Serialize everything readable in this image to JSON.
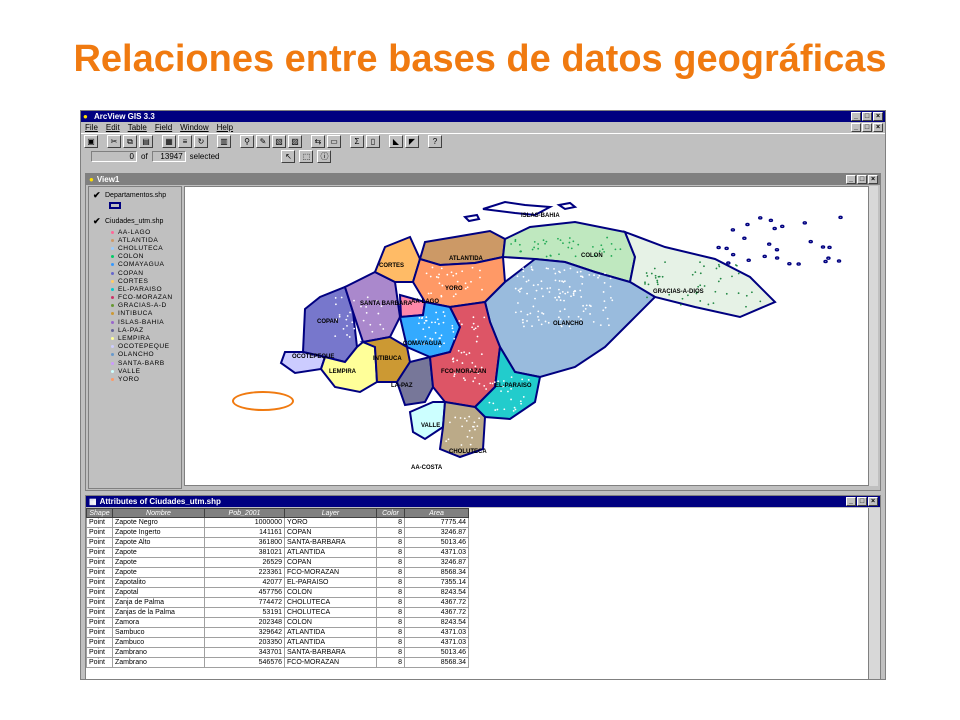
{
  "slide": {
    "title": "Relaciones entre bases de datos geográficas"
  },
  "app": {
    "title": "ArcView GIS 3.3",
    "menu": [
      "File",
      "Edit",
      "Table",
      "Field",
      "Window",
      "Help"
    ],
    "status": {
      "selected_count": "0",
      "of_label": "of",
      "total": "13947",
      "selected_label": "selected"
    }
  },
  "view": {
    "title": "View1",
    "toc": {
      "layer1": "Departamentos.shp",
      "layer2": "Ciudades_utm.shp",
      "legend": [
        {
          "label": "AA-LAGO",
          "color": "#ff6699"
        },
        {
          "label": "ATLANTIDA",
          "color": "#cc9966"
        },
        {
          "label": "CHOLUTECA",
          "color": "#99ccff"
        },
        {
          "label": "COLON",
          "color": "#00cc66"
        },
        {
          "label": "COMAYAGUA",
          "color": "#3399ff"
        },
        {
          "label": "COPAN",
          "color": "#6666cc"
        },
        {
          "label": "CORTES",
          "color": "#ffcc66"
        },
        {
          "label": "EL-PARAISO",
          "color": "#00cccc"
        },
        {
          "label": "FCO-MORAZAN",
          "color": "#cc3366"
        },
        {
          "label": "GRACIAS-A-D",
          "color": "#669933"
        },
        {
          "label": "INTIBUCA",
          "color": "#cc9933"
        },
        {
          "label": "ISLAS-BAHIA",
          "color": "#9966cc"
        },
        {
          "label": "LA-PAZ",
          "color": "#666699"
        },
        {
          "label": "LEMPIRA",
          "color": "#ffff99"
        },
        {
          "label": "OCOTEPEQUE",
          "color": "#ccccff"
        },
        {
          "label": "OLANCHO",
          "color": "#6699cc"
        },
        {
          "label": "SANTA-BARB",
          "color": "#cc99ff"
        },
        {
          "label": "VALLE",
          "color": "#ccffff"
        },
        {
          "label": "YORO",
          "color": "#ff9966"
        }
      ]
    },
    "map_labels": {
      "islas_bahia": "ISLAS-BAHIA",
      "colon": "COLON",
      "atlantida": "ATLANTIDA",
      "cortes": "CORTES",
      "yoro": "YORO",
      "gracias": "GRACIAS-A-DIOS",
      "santa_barbara": "SANTA\nBARBARA",
      "aa_lago": "AA-LAGO",
      "copan": "COPAN",
      "olancho": "OLANCHO",
      "comayagua": "COMAYAGUA",
      "ocotepeque": "OCOTEPEQUE",
      "intibuca": "INTIBUCA",
      "lempira": "LEMPIRA",
      "fco_morazan": "FCO-MORAZAN",
      "la_paz": "LA-PAZ",
      "el_paraiso": "EL-PARAISO",
      "valle": "VALLE",
      "choluteca": "CHOLUTECA",
      "aa_costa": "AA-COSTA"
    },
    "colors": {
      "border": "#000080"
    }
  },
  "attributes": {
    "title": "Attributes of Ciudades_utm.shp",
    "columns": [
      "Shape",
      "Nombre",
      "Pob_2001",
      "Layer",
      "Color",
      "Area"
    ],
    "rows": [
      [
        "Point",
        "Zapote Negro",
        "1000000",
        "YORO",
        "8",
        "7775.44"
      ],
      [
        "Point",
        "Zapote Ingerto",
        "141161",
        "COPAN",
        "8",
        "3246.87"
      ],
      [
        "Point",
        "Zapote Alto",
        "361800",
        "SANTA-BARBARA",
        "8",
        "5013.46"
      ],
      [
        "Point",
        "Zapote",
        "381021",
        "ATLANTIDA",
        "8",
        "4371.03"
      ],
      [
        "Point",
        "Zapote",
        "26529",
        "COPAN",
        "8",
        "3246.87"
      ],
      [
        "Point",
        "Zapote",
        "223361",
        "FCO-MORAZAN",
        "8",
        "8568.34"
      ],
      [
        "Point",
        "Zapotalito",
        "42077",
        "EL-PARAISO",
        "8",
        "7355.14"
      ],
      [
        "Point",
        "Zapotal",
        "457756",
        "COLON",
        "8",
        "8243.54"
      ],
      [
        "Point",
        "Zanja de Palma",
        "774472",
        "CHOLUTECA",
        "8",
        "4367.72"
      ],
      [
        "Point",
        "Zanjas de la Palma",
        "53191",
        "CHOLUTECA",
        "8",
        "4367.72"
      ],
      [
        "Point",
        "Zamora",
        "202348",
        "COLON",
        "8",
        "8243.54"
      ],
      [
        "Point",
        "Sambuco",
        "329642",
        "ATLANTIDA",
        "8",
        "4371.03"
      ],
      [
        "Point",
        "Zambuco",
        "203350",
        "ATLANTIDA",
        "8",
        "4371.03"
      ],
      [
        "Point",
        "Zambrano",
        "343701",
        "SANTA-BARBARA",
        "8",
        "5013.46"
      ],
      [
        "Point",
        "Zambrano",
        "546576",
        "FCO-MORAZAN",
        "8",
        "8568.34"
      ]
    ]
  },
  "highlight_color": "#f07a10"
}
